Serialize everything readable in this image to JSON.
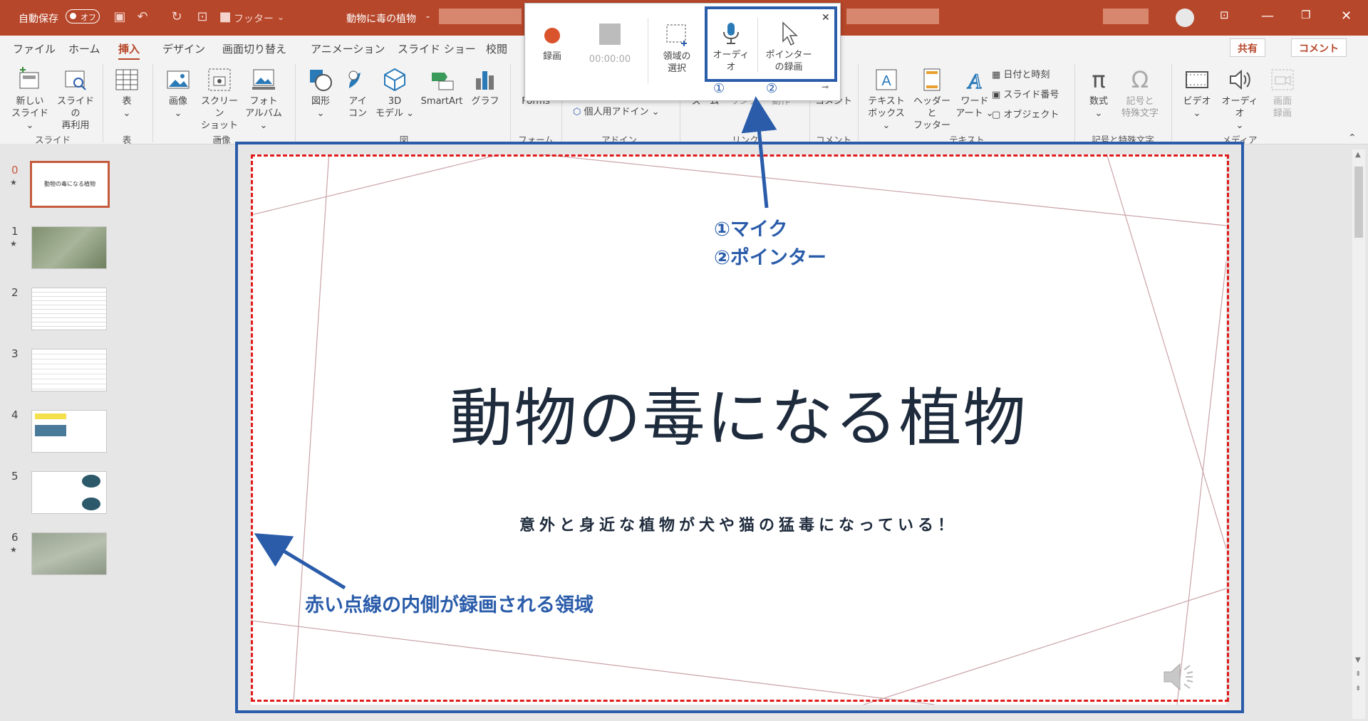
{
  "titlebar": {
    "autosave_label": "自動保存",
    "autosave_state": "オフ",
    "footer_label": "フッター",
    "doc_title": "動物に毒の植物",
    "title_sep": "-"
  },
  "tabs": [
    "ファイル",
    "ホーム",
    "挿入",
    "デザイン",
    "画面切り替え",
    "アニメーション",
    "スライド ショー",
    "校閲"
  ],
  "tabs_right": {
    "share": "共有",
    "comment": "コメント"
  },
  "ribbon": {
    "new_slide": [
      "新しい",
      "スライド ⌄"
    ],
    "reuse": [
      "スライドの",
      "再利用"
    ],
    "table": [
      "表",
      "⌄"
    ],
    "image": [
      "画像",
      "⌄"
    ],
    "screenshot": [
      "スクリーン",
      "ショット ⌄"
    ],
    "album": [
      "フォト",
      "アルバム ⌄"
    ],
    "shape": [
      "図形",
      "⌄"
    ],
    "icon": [
      "アイ",
      "コン"
    ],
    "model3d": [
      "3D",
      "モデル ⌄"
    ],
    "smartart": "SmartArt",
    "graph": "グラフ",
    "forms": "Forms",
    "addin": "個人用アドイン ⌄",
    "zoom": "ズーム",
    "link": "リンク",
    "action": "動作",
    "comment": "コメント",
    "textbox": [
      "テキスト",
      "ボックス ⌄"
    ],
    "headerfooter": [
      "ヘッダーと",
      "フッター"
    ],
    "wordart": [
      "ワード",
      "アート ⌄"
    ],
    "datetime": "日付と時刻",
    "slidenum": "スライド番号",
    "object": "オブジェクト",
    "equation": [
      "数式",
      "⌄"
    ],
    "symbol": [
      "記号と",
      "特殊文字"
    ],
    "video": [
      "ビデオ",
      "⌄"
    ],
    "audio": [
      "オーディオ",
      "⌄"
    ],
    "screenrec": [
      "画面",
      "録画"
    ],
    "groups": {
      "slide": "スライド",
      "table": "表",
      "image": "画像",
      "fig": "図",
      "form": "フォーム",
      "addin": "アドイン",
      "link": "リンク",
      "comment": "コメント",
      "text": "テキスト",
      "symbols": "記号と特殊文字",
      "media": "メディア"
    }
  },
  "recorder": {
    "record": "録画",
    "time": "00:00:00",
    "select_area": [
      "領域の",
      "選択"
    ],
    "audio": [
      "オーディ",
      "オ"
    ],
    "pointer": [
      "ポインター",
      "の録画"
    ],
    "mark1": "①",
    "mark2": "②"
  },
  "slides": [
    {
      "num": "0",
      "star": "★"
    },
    {
      "num": "1",
      "star": "★"
    },
    {
      "num": "2",
      "star": ""
    },
    {
      "num": "3",
      "star": ""
    },
    {
      "num": "4",
      "star": ""
    },
    {
      "num": "5",
      "star": ""
    },
    {
      "num": "6",
      "star": "★"
    }
  ],
  "thumb_title": "動物の毒になる植物",
  "slide": {
    "title": "動物の毒になる植物",
    "subtitle": "意外と身近な植物が犬や猫の猛毒になっている！"
  },
  "annotations": {
    "mic": "①マイク",
    "pointer": "②ポインター",
    "area": "赤い点線の内側が録画される領域"
  },
  "colors": {
    "accent": "#b7472a",
    "annotation": "#2a5caa",
    "dashed": "#e01b1b"
  }
}
